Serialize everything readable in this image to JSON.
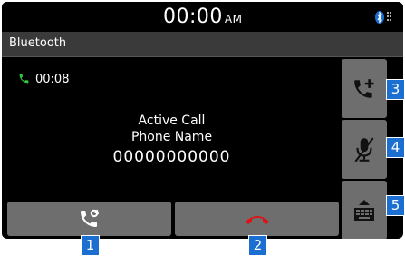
{
  "status_bar": {
    "time": "00:00",
    "period": "AM"
  },
  "header": {
    "title": "Bluetooth"
  },
  "call": {
    "duration": "00:08",
    "status": "Active Call",
    "name": "Phone Name",
    "number": "00000000000"
  },
  "callouts": [
    "1",
    "2",
    "3",
    "4",
    "5"
  ],
  "colors": {
    "call_green": "#2ecc40",
    "end_red": "#e01010",
    "accent_blue": "#1a6fd0"
  }
}
